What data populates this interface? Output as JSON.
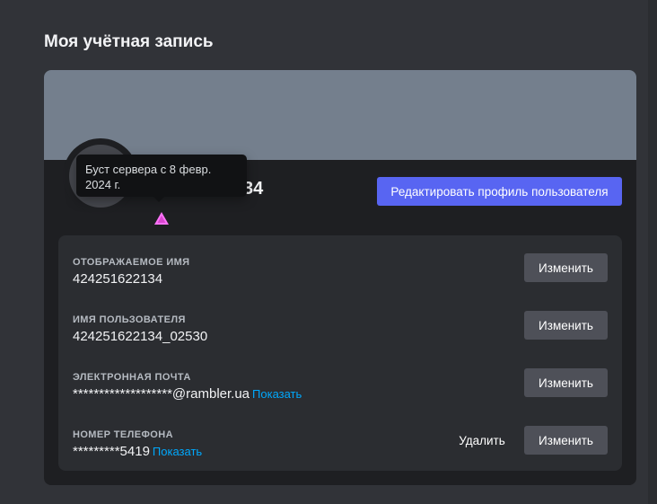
{
  "page": {
    "title": "Моя учётная запись"
  },
  "colors": {
    "accent": "#5865f2",
    "banner": "#747f8d",
    "link": "#00a8fc",
    "boost_badge": "#ff73fa"
  },
  "profile": {
    "username_visible_suffix": "34",
    "edit_button_label": "Редактировать профиль пользователя",
    "badge_icon": "server-boost-icon",
    "boost_tooltip": "Буст сервера с 8 февр. 2024 г."
  },
  "fields": {
    "display_name": {
      "label": "ОТОБРАЖАЕМОЕ ИМЯ",
      "value": "424251622134",
      "change_label": "Изменить"
    },
    "username": {
      "label": "ИМЯ ПОЛЬЗОВАТЕЛЯ",
      "value": "424251622134_02530",
      "change_label": "Изменить"
    },
    "email": {
      "label": "ЭЛЕКТРОННАЯ ПОЧТА",
      "value": "*******************@rambler.ua",
      "reveal_label": "Показать",
      "change_label": "Изменить"
    },
    "phone": {
      "label": "НОМЕР ТЕЛЕФОНА",
      "value": "*********5419",
      "reveal_label": "Показать",
      "remove_label": "Удалить",
      "change_label": "Изменить"
    }
  }
}
